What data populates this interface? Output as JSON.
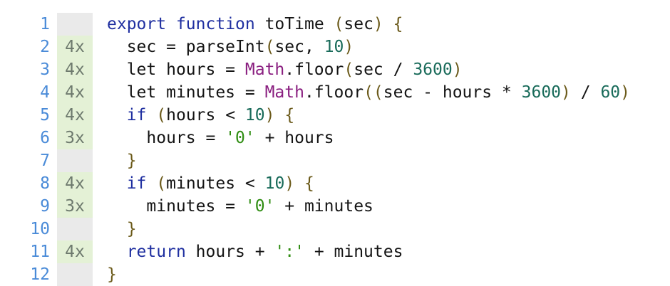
{
  "colors": {
    "line_number": "#4a8bd8",
    "hit_count": "#6e7a6e",
    "covered_bg": "#e4f1d6",
    "neutral_bg": "#eaeaea",
    "keyword": "#1f2fa0",
    "number": "#196b5a",
    "string": "#2f8d12",
    "global": "#8a1f80",
    "punctuation": "#6b5a1a",
    "plain": "#141414"
  },
  "lines": [
    {
      "number": "1",
      "hits": "",
      "covered": false,
      "indent": "",
      "tokens": [
        {
          "t": "export",
          "k": "kw"
        },
        {
          "t": " ",
          "k": "plain"
        },
        {
          "t": "function",
          "k": "kw"
        },
        {
          "t": " toTime ",
          "k": "plain"
        },
        {
          "t": "(",
          "k": "punc"
        },
        {
          "t": "sec",
          "k": "plain"
        },
        {
          "t": ")",
          "k": "punc"
        },
        {
          "t": " ",
          "k": "plain"
        },
        {
          "t": "{",
          "k": "punc"
        }
      ]
    },
    {
      "number": "2",
      "hits": "4x",
      "covered": true,
      "indent": "  ",
      "tokens": [
        {
          "t": "sec = parseInt",
          "k": "plain"
        },
        {
          "t": "(",
          "k": "punc"
        },
        {
          "t": "sec, ",
          "k": "plain"
        },
        {
          "t": "10",
          "k": "num"
        },
        {
          "t": ")",
          "k": "punc"
        }
      ]
    },
    {
      "number": "3",
      "hits": "4x",
      "covered": true,
      "indent": "  ",
      "tokens": [
        {
          "t": "let hours = ",
          "k": "plain"
        },
        {
          "t": "Math",
          "k": "glob"
        },
        {
          "t": ".floor",
          "k": "plain"
        },
        {
          "t": "(",
          "k": "punc"
        },
        {
          "t": "sec / ",
          "k": "plain"
        },
        {
          "t": "3600",
          "k": "num"
        },
        {
          "t": ")",
          "k": "punc"
        }
      ]
    },
    {
      "number": "4",
      "hits": "4x",
      "covered": true,
      "indent": "  ",
      "tokens": [
        {
          "t": "let minutes = ",
          "k": "plain"
        },
        {
          "t": "Math",
          "k": "glob"
        },
        {
          "t": ".floor",
          "k": "plain"
        },
        {
          "t": "((",
          "k": "punc"
        },
        {
          "t": "sec - hours * ",
          "k": "plain"
        },
        {
          "t": "3600",
          "k": "num"
        },
        {
          "t": ")",
          "k": "punc"
        },
        {
          "t": " / ",
          "k": "plain"
        },
        {
          "t": "60",
          "k": "num"
        },
        {
          "t": ")",
          "k": "punc"
        }
      ]
    },
    {
      "number": "5",
      "hits": "4x",
      "covered": true,
      "indent": "  ",
      "tokens": [
        {
          "t": "if",
          "k": "kw"
        },
        {
          "t": " ",
          "k": "plain"
        },
        {
          "t": "(",
          "k": "punc"
        },
        {
          "t": "hours < ",
          "k": "plain"
        },
        {
          "t": "10",
          "k": "num"
        },
        {
          "t": ")",
          "k": "punc"
        },
        {
          "t": " ",
          "k": "plain"
        },
        {
          "t": "{",
          "k": "punc"
        }
      ]
    },
    {
      "number": "6",
      "hits": "3x",
      "covered": true,
      "indent": "    ",
      "tokens": [
        {
          "t": "hours = ",
          "k": "plain"
        },
        {
          "t": "'0'",
          "k": "str"
        },
        {
          "t": " + hours",
          "k": "plain"
        }
      ]
    },
    {
      "number": "7",
      "hits": "",
      "covered": false,
      "indent": "  ",
      "tokens": [
        {
          "t": "}",
          "k": "punc"
        }
      ]
    },
    {
      "number": "8",
      "hits": "4x",
      "covered": true,
      "indent": "  ",
      "tokens": [
        {
          "t": "if",
          "k": "kw"
        },
        {
          "t": " ",
          "k": "plain"
        },
        {
          "t": "(",
          "k": "punc"
        },
        {
          "t": "minutes < ",
          "k": "plain"
        },
        {
          "t": "10",
          "k": "num"
        },
        {
          "t": ")",
          "k": "punc"
        },
        {
          "t": " ",
          "k": "plain"
        },
        {
          "t": "{",
          "k": "punc"
        }
      ]
    },
    {
      "number": "9",
      "hits": "3x",
      "covered": true,
      "indent": "    ",
      "tokens": [
        {
          "t": "minutes = ",
          "k": "plain"
        },
        {
          "t": "'0'",
          "k": "str"
        },
        {
          "t": " + minutes",
          "k": "plain"
        }
      ]
    },
    {
      "number": "10",
      "hits": "",
      "covered": false,
      "indent": "  ",
      "tokens": [
        {
          "t": "}",
          "k": "punc"
        }
      ]
    },
    {
      "number": "11",
      "hits": "4x",
      "covered": true,
      "indent": "  ",
      "tokens": [
        {
          "t": "return",
          "k": "kw"
        },
        {
          "t": " hours + ",
          "k": "plain"
        },
        {
          "t": "':'",
          "k": "str"
        },
        {
          "t": " + minutes",
          "k": "plain"
        }
      ]
    },
    {
      "number": "12",
      "hits": "",
      "covered": false,
      "indent": "",
      "tokens": [
        {
          "t": "}",
          "k": "punc"
        }
      ]
    }
  ]
}
